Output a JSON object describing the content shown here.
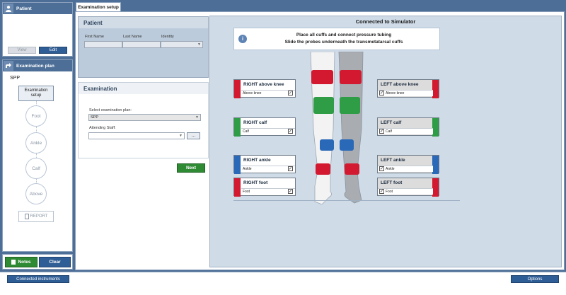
{
  "colors": {
    "accent": "#4d6f97",
    "red": "#d2192f",
    "green": "#2f9c46",
    "blue": "#2a68b8",
    "next_green": "#2f8a34"
  },
  "patient_panel": {
    "title": "Patient",
    "view_label": "View",
    "edit_label": "Edit"
  },
  "exam_plan_panel": {
    "title": "Examination plan",
    "plan_name": "SPP",
    "steps": [
      {
        "label": "Examination setup"
      },
      {
        "label": "Foot"
      },
      {
        "label": "Ankle"
      },
      {
        "label": "Calf"
      },
      {
        "label": "Above"
      }
    ],
    "report_label": "REPORT"
  },
  "bottom_left": {
    "notes_label": "Notes",
    "clear_label": "Clear"
  },
  "tab": {
    "label": "Examination setup"
  },
  "patient_form": {
    "title": "Patient",
    "first_name_label": "First Name",
    "last_name_label": "Last Name",
    "identity_label": "Identity",
    "first_name": "",
    "last_name": "",
    "identity": ""
  },
  "examination_form": {
    "title": "Examination",
    "plan_label": "Select examination plan:",
    "plan_value": "SPP",
    "staff_label": "Attending Staff:",
    "staff_value": "",
    "browse_label": "...",
    "next_label": "Next"
  },
  "simulator": {
    "title": "Connected to Simulator",
    "instruction_line1": "Place all cuffs and connect pressure tubing",
    "instruction_line2": "Slide the probes underneath the transmetatarsal cuffs",
    "right_cuffs": [
      {
        "title": "RIGHT above knee",
        "sub": "Above knee",
        "checked": true,
        "color": "#d2192f"
      },
      {
        "title": "RIGHT calf",
        "sub": "Calf",
        "checked": true,
        "color": "#2f9c46"
      },
      {
        "title": "RIGHT ankle",
        "sub": "Ankle",
        "checked": true,
        "color": "#2a68b8"
      },
      {
        "title": "RIGHT foot",
        "sub": "Foot",
        "checked": true,
        "color": "#d2192f"
      }
    ],
    "left_cuffs": [
      {
        "title": "LEFT above knee",
        "sub": "Above knee",
        "checked": true,
        "color": "#d2192f"
      },
      {
        "title": "LEFT calf",
        "sub": "Calf",
        "checked": true,
        "color": "#2f9c46"
      },
      {
        "title": "LEFT ankle",
        "sub": "Ankle",
        "checked": true,
        "color": "#2a68b8"
      },
      {
        "title": "LEFT foot",
        "sub": "Foot",
        "checked": true,
        "color": "#d2192f"
      }
    ]
  },
  "footer": {
    "connected_label": "Connected instruments",
    "options_label": "Options"
  }
}
